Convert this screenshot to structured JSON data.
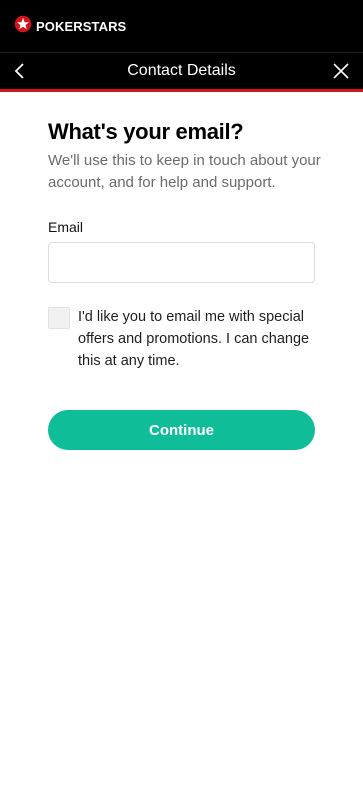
{
  "brand": {
    "name": "POKERSTARS",
    "logo_icon": "pokerstars-star-icon",
    "accent": "#d3141b"
  },
  "header": {
    "title": "Contact Details",
    "back_icon": "chevron-left-icon",
    "close_icon": "close-icon"
  },
  "main": {
    "heading": "What's your email?",
    "subtext": "We'll use this to keep in touch about your account, and for help and support.",
    "email": {
      "label": "Email",
      "value": "",
      "placeholder": ""
    },
    "consent": {
      "checked": false,
      "text": "I'd like you to email me with special offers and promotions. I can change this at any time."
    },
    "continue_label": "Continue",
    "button_color": "#0fbd98"
  }
}
